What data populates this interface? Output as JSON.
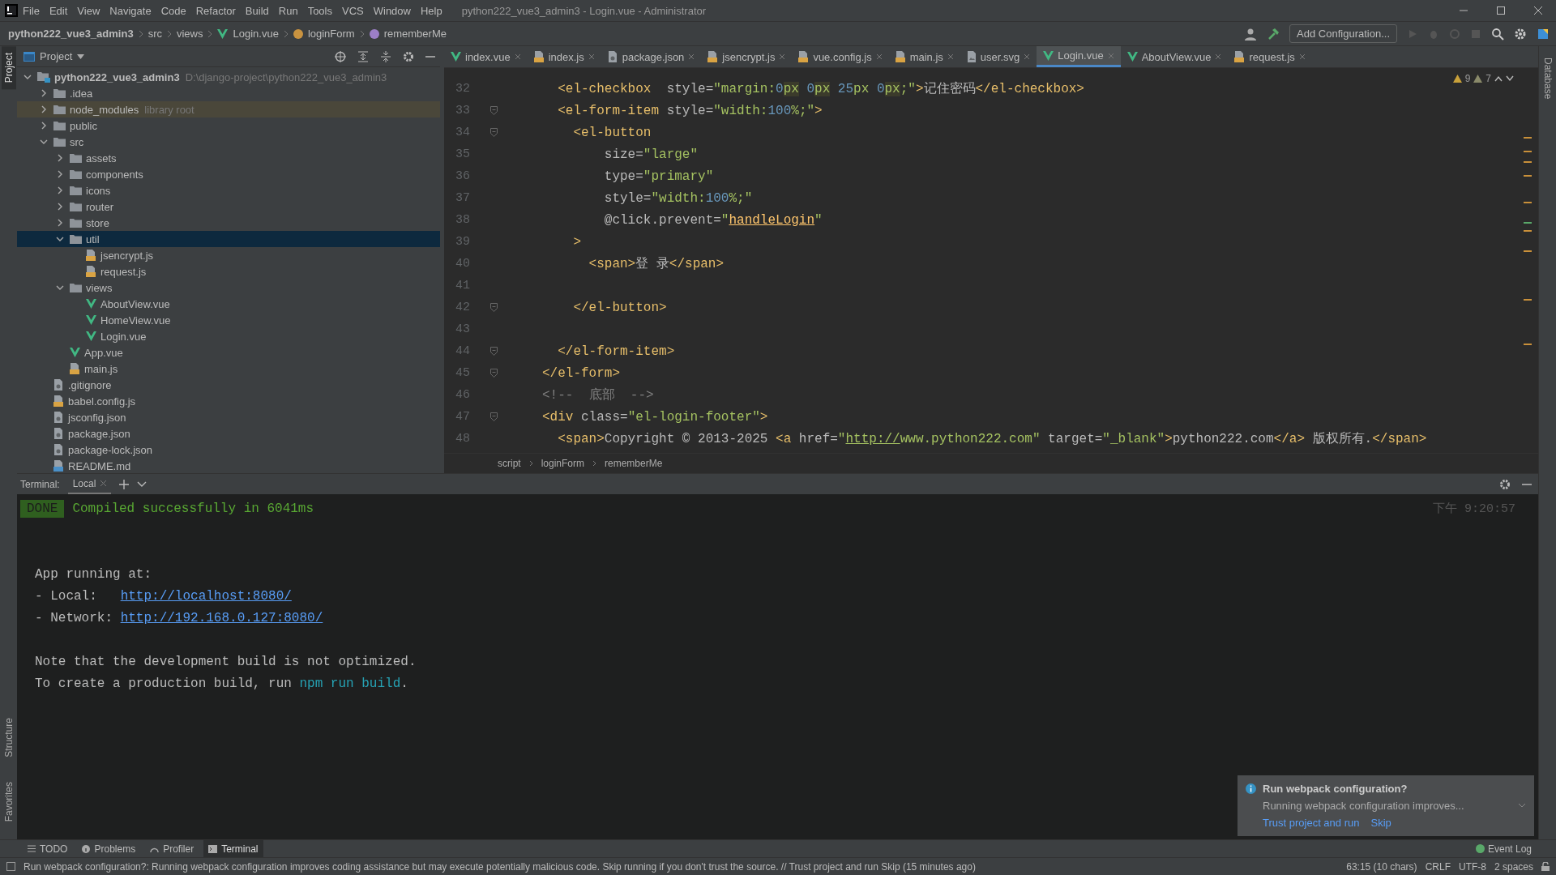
{
  "menu_bar": {
    "items": [
      "File",
      "Edit",
      "View",
      "Navigate",
      "Code",
      "Refactor",
      "Build",
      "Run",
      "Tools",
      "VCS",
      "Window",
      "Help"
    ],
    "title": "python222_vue3_admin3 - Login.vue - Administrator"
  },
  "nav_bar": {
    "breadcrumb": [
      {
        "label": "python222_vue3_admin3",
        "kind": "project"
      },
      {
        "label": "src",
        "kind": "folder"
      },
      {
        "label": "views",
        "kind": "folder"
      },
      {
        "label": "Login.vue",
        "kind": "vue"
      },
      {
        "label": "loginForm",
        "kind": "property"
      },
      {
        "label": "rememberMe",
        "kind": "field"
      }
    ],
    "run_config": "Add Configuration..."
  },
  "side_bars": {
    "left_top": "Project",
    "left_middle": "Structure",
    "left_bottom": "Favorites",
    "right": "Database"
  },
  "project_panel": {
    "title": "Project",
    "tree": [
      {
        "label": "python222_vue3_admin3",
        "hint": "D:\\django-project\\python222_vue3_admin3",
        "kind": "root",
        "expanded": true,
        "selected": false,
        "children": [
          {
            "label": ".idea",
            "kind": "folder",
            "expanded": false,
            "selected": false
          },
          {
            "label": "node_modules",
            "hint": "library root",
            "kind": "library",
            "expanded": false,
            "selected": false
          },
          {
            "label": "public",
            "kind": "folder",
            "expanded": false,
            "selected": false
          },
          {
            "label": "src",
            "kind": "folder",
            "expanded": true,
            "selected": false,
            "children": [
              {
                "label": "assets",
                "kind": "folder",
                "expanded": false,
                "selected": false
              },
              {
                "label": "components",
                "kind": "folder",
                "expanded": false,
                "selected": false
              },
              {
                "label": "icons",
                "kind": "folder",
                "expanded": false,
                "selected": false
              },
              {
                "label": "router",
                "kind": "folder",
                "expanded": false,
                "selected": false
              },
              {
                "label": "store",
                "kind": "folder",
                "expanded": false,
                "selected": false
              },
              {
                "label": "util",
                "kind": "folder",
                "expanded": true,
                "selected": true,
                "children": [
                  {
                    "label": "jsencrypt.js",
                    "kind": "js",
                    "selected": false
                  },
                  {
                    "label": "request.js",
                    "kind": "js",
                    "selected": false
                  }
                ]
              },
              {
                "label": "views",
                "kind": "folder",
                "expanded": true,
                "selected": false,
                "children": [
                  {
                    "label": "AboutView.vue",
                    "kind": "vue",
                    "selected": false
                  },
                  {
                    "label": "HomeView.vue",
                    "kind": "vue",
                    "selected": false
                  },
                  {
                    "label": "Login.vue",
                    "kind": "vue",
                    "selected": false
                  }
                ]
              },
              {
                "label": "App.vue",
                "kind": "vue",
                "selected": false
              },
              {
                "label": "main.js",
                "kind": "js",
                "selected": false
              }
            ]
          },
          {
            "label": ".gitignore",
            "kind": "config",
            "selected": false
          },
          {
            "label": "babel.config.js",
            "kind": "js",
            "selected": false
          },
          {
            "label": "jsconfig.json",
            "kind": "config",
            "selected": false
          },
          {
            "label": "package.json",
            "kind": "config",
            "selected": false
          },
          {
            "label": "package-lock.json",
            "kind": "config",
            "selected": false
          },
          {
            "label": "README.md",
            "kind": "md",
            "selected": false
          }
        ]
      }
    ]
  },
  "editor": {
    "tabs": [
      {
        "label": "index.vue",
        "kind": "vue",
        "selected": false
      },
      {
        "label": "index.js",
        "kind": "js",
        "selected": false
      },
      {
        "label": "package.json",
        "kind": "config",
        "selected": false
      },
      {
        "label": "jsencrypt.js",
        "kind": "js",
        "selected": false
      },
      {
        "label": "vue.config.js",
        "kind": "js",
        "selected": false
      },
      {
        "label": "main.js",
        "kind": "js",
        "selected": false
      },
      {
        "label": "user.svg",
        "kind": "svg",
        "selected": false
      },
      {
        "label": "Login.vue",
        "kind": "vue",
        "selected": true
      },
      {
        "label": "AboutView.vue",
        "kind": "vue",
        "selected": false
      },
      {
        "label": "request.js",
        "kind": "js",
        "selected": false
      }
    ],
    "warnings": "9",
    "weak_warnings": "7",
    "lines": [
      {
        "number": "32",
        "fold": false,
        "tokens": [
          {
            "kind": "tag",
            "text": "  <el-checkbox"
          },
          {
            "kind": "attr",
            "text": "  style="
          },
          {
            "kind": "string",
            "text": "\"margin:"
          },
          {
            "kind": "number",
            "text": "0"
          },
          {
            "kind": "unit",
            "text": "px"
          },
          {
            "kind": "number",
            "text": " 0"
          },
          {
            "kind": "unit",
            "text": "px"
          },
          {
            "kind": "number",
            "text": " 25"
          },
          {
            "kind": "string",
            "text": "px "
          },
          {
            "kind": "number",
            "text": "0"
          },
          {
            "kind": "unit",
            "text": "px"
          },
          {
            "kind": "string",
            "text": ";\""
          },
          {
            "kind": "tag",
            "text": ">"
          },
          {
            "kind": "text",
            "text": "记住密码"
          },
          {
            "kind": "tag",
            "text": "</el-checkbox>"
          }
        ]
      },
      {
        "number": "33",
        "fold": true,
        "tokens": [
          {
            "kind": "tag",
            "text": "  <el-form-item"
          },
          {
            "kind": "attr",
            "text": " style="
          },
          {
            "kind": "string",
            "text": "\"width:"
          },
          {
            "kind": "number",
            "text": "100"
          },
          {
            "kind": "string",
            "text": "%;\""
          },
          {
            "kind": "tag",
            "text": ">"
          }
        ]
      },
      {
        "number": "34",
        "fold": true,
        "tokens": [
          {
            "kind": "tag",
            "text": "    <el-button"
          }
        ]
      },
      {
        "number": "35",
        "fold": false,
        "tokens": [
          {
            "kind": "attr",
            "text": "        size="
          },
          {
            "kind": "string",
            "text": "\"large\""
          }
        ]
      },
      {
        "number": "36",
        "fold": false,
        "tokens": [
          {
            "kind": "attr",
            "text": "        type="
          },
          {
            "kind": "string",
            "text": "\"primary\""
          }
        ]
      },
      {
        "number": "37",
        "fold": false,
        "tokens": [
          {
            "kind": "attr",
            "text": "        style="
          },
          {
            "kind": "string",
            "text": "\"width:"
          },
          {
            "kind": "number",
            "text": "100"
          },
          {
            "kind": "string",
            "text": "%;\""
          }
        ]
      },
      {
        "number": "38",
        "fold": false,
        "tokens": [
          {
            "kind": "attr",
            "text": "        @click.prevent="
          },
          {
            "kind": "string",
            "text": "\""
          },
          {
            "kind": "func",
            "text": "handleLogin"
          },
          {
            "kind": "string",
            "text": "\""
          }
        ]
      },
      {
        "number": "39",
        "fold": false,
        "tokens": [
          {
            "kind": "tag",
            "text": "    >"
          }
        ]
      },
      {
        "number": "40",
        "fold": false,
        "tokens": [
          {
            "kind": "tag",
            "text": "      <span>"
          },
          {
            "kind": "text",
            "text": "登 录"
          },
          {
            "kind": "tag",
            "text": "</span>"
          }
        ]
      },
      {
        "number": "41",
        "fold": false
      },
      {
        "number": "42",
        "fold": true,
        "tokens": [
          {
            "kind": "tag",
            "text": "    </el-button>"
          }
        ]
      },
      {
        "number": "43",
        "fold": false
      },
      {
        "number": "44",
        "fold": true,
        "tokens": [
          {
            "kind": "tag",
            "text": "  </el-form-item>"
          }
        ]
      },
      {
        "number": "45",
        "fold": true,
        "tokens": [
          {
            "kind": "tag",
            "text": "</el-form>"
          }
        ]
      },
      {
        "number": "46",
        "fold": false,
        "tokens": [
          {
            "kind": "comment",
            "text": "<!--  底部  -->"
          }
        ]
      },
      {
        "number": "47",
        "fold": true,
        "tokens": [
          {
            "kind": "tag",
            "text": "<div"
          },
          {
            "kind": "attr",
            "text": " class="
          },
          {
            "kind": "string",
            "text": "\"el-login-footer\""
          },
          {
            "kind": "tag",
            "text": ">"
          }
        ]
      },
      {
        "number": "48",
        "fold": false,
        "tokens": [
          {
            "kind": "tag",
            "text": "  <span>"
          },
          {
            "kind": "text",
            "text": "Copyright © 2013-2025 "
          },
          {
            "kind": "tag",
            "text": "<a"
          },
          {
            "kind": "attr",
            "text": " href="
          },
          {
            "kind": "string",
            "text": "\""
          },
          {
            "kind": "link",
            "text": "http://"
          },
          {
            "kind": "string",
            "text": "www.python222.com\""
          },
          {
            "kind": "attr",
            "text": " target="
          },
          {
            "kind": "string",
            "text": "\"_blank\""
          },
          {
            "kind": "tag",
            "text": ">"
          },
          {
            "kind": "text",
            "text": "python222.com"
          },
          {
            "kind": "tag",
            "text": "</a>"
          },
          {
            "kind": "text",
            "text": " 版权所有."
          },
          {
            "kind": "tag",
            "text": "</span>"
          }
        ]
      }
    ],
    "breadcrumb": [
      "script",
      "loginForm",
      "rememberMe"
    ]
  },
  "terminal": {
    "label": "Terminal:",
    "tabs": [
      {
        "label": "Local",
        "selected": true
      }
    ],
    "time": "下午 9:20:57",
    "blocks": [
      [
        {
          "kind": "status",
          "badge": "DONE",
          "text": "Compiled successfully in 6041ms"
        }
      ],
      [
        {
          "kind": "output",
          "segments": [
            {
              "kind": "text",
              "text": "App running at:"
            }
          ]
        },
        {
          "kind": "output",
          "segments": [
            {
              "kind": "text",
              "text": "- Local:   "
            },
            {
              "kind": "link",
              "text": "http://localhost:8080/"
            }
          ]
        },
        {
          "kind": "output",
          "segments": [
            {
              "kind": "text",
              "text": "- Network: "
            },
            {
              "kind": "link",
              "text": "http://192.168.0.127:8080/"
            }
          ]
        }
      ],
      [
        {
          "kind": "output",
          "segments": [
            {
              "kind": "text",
              "text": "Note that the development build is not optimized."
            }
          ]
        },
        {
          "kind": "output",
          "segments": [
            {
              "kind": "text",
              "text": "To create a production build, run "
            },
            {
              "kind": "command",
              "text": "npm run build"
            },
            {
              "kind": "text",
              "text": "."
            }
          ]
        }
      ]
    ]
  },
  "tool_tabs": [
    {
      "label": "TODO",
      "kind": "list",
      "selected": false
    },
    {
      "label": "Problems",
      "kind": "info",
      "selected": false
    },
    {
      "label": "Profiler",
      "kind": "profiler",
      "selected": false
    },
    {
      "label": "Terminal",
      "kind": "terminal",
      "selected": true
    }
  ],
  "notification": {
    "title": "Run webpack configuration?",
    "body": "Running webpack configuration improves...",
    "actions": [
      "Trust project and run",
      "Skip"
    ]
  },
  "event_log": "Event Log",
  "status_bar": {
    "message": "Run webpack configuration?: Running webpack configuration improves coding assistance but may execute potentially malicious code. Skip running if you don't trust the source. // Trust project and run   Skip (15 minutes ago)",
    "position": "63:15 (10 chars)",
    "line_separator": "CRLF",
    "encoding": "UTF-8",
    "indent": "2 spaces"
  }
}
